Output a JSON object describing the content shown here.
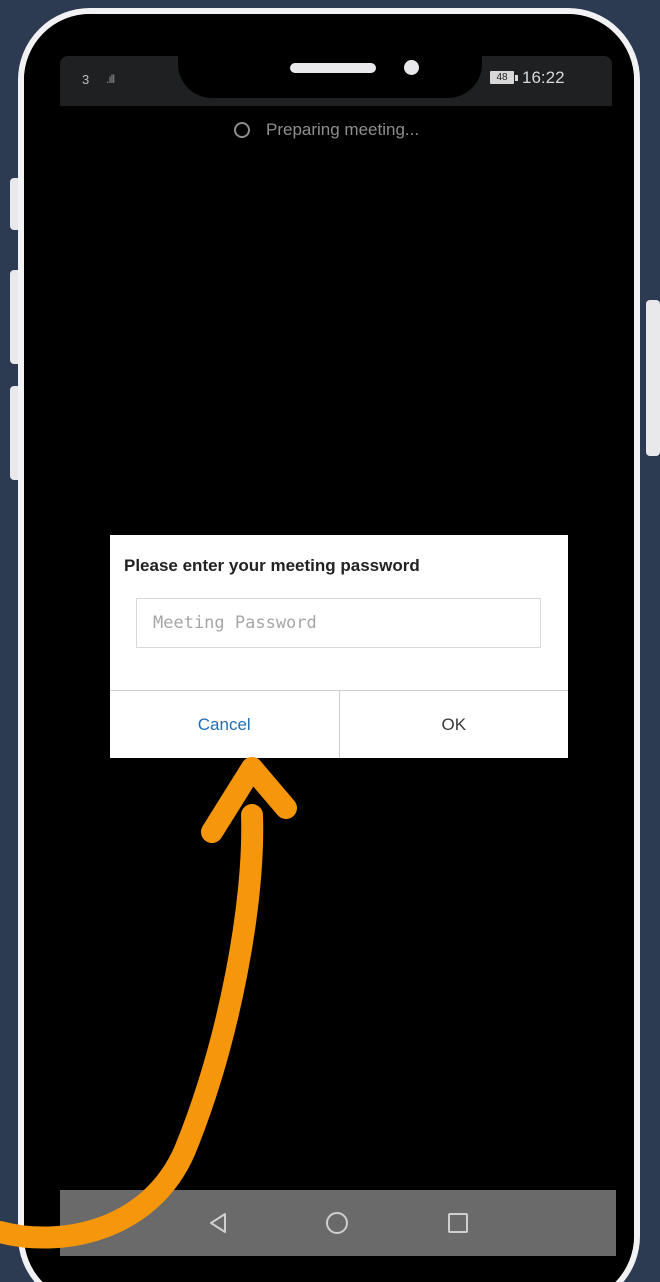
{
  "status_bar": {
    "carrier": "3",
    "signal": ".ıll",
    "battery": "48",
    "time": "16:22"
  },
  "loading": {
    "text": "Preparing meeting..."
  },
  "dialog": {
    "title": "Please enter your meeting password",
    "password_placeholder": "Meeting Password",
    "password_value": "",
    "cancel_label": "Cancel",
    "ok_label": "OK"
  },
  "nav_bar": {
    "icons": [
      "back-icon",
      "home-icon",
      "recent-apps-icon"
    ]
  },
  "colors": {
    "background": "#2c3a52",
    "annotation_arrow": "#f5960b",
    "cancel_text": "#1e6fb8",
    "screen": "#000000",
    "dialog": "#ffffff"
  }
}
